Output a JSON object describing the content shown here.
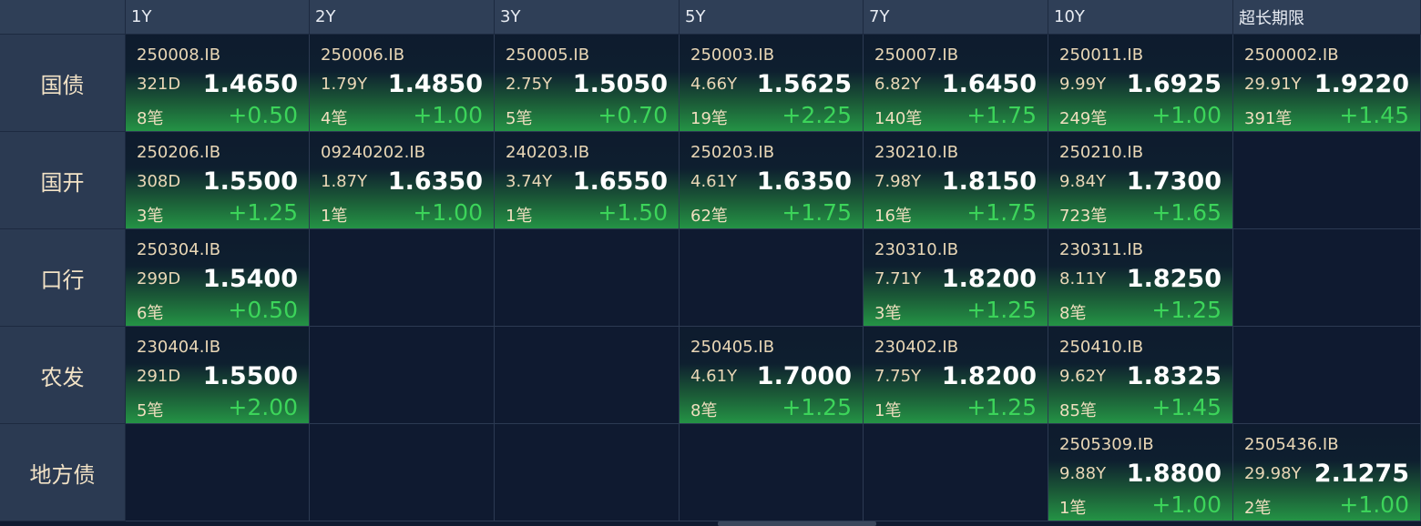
{
  "columns": [
    "1Y",
    "2Y",
    "3Y",
    "5Y",
    "7Y",
    "10Y",
    "超长期限"
  ],
  "rows": [
    {
      "label": "国债",
      "cells": [
        {
          "code": "250008.IB",
          "tenor": "321D",
          "yield": "1.4650",
          "count": "8笔",
          "change": "+0.50"
        },
        {
          "code": "250006.IB",
          "tenor": "1.79Y",
          "yield": "1.4850",
          "count": "4笔",
          "change": "+1.00"
        },
        {
          "code": "250005.IB",
          "tenor": "2.75Y",
          "yield": "1.5050",
          "count": "5笔",
          "change": "+0.70"
        },
        {
          "code": "250003.IB",
          "tenor": "4.66Y",
          "yield": "1.5625",
          "count": "19笔",
          "change": "+2.25"
        },
        {
          "code": "250007.IB",
          "tenor": "6.82Y",
          "yield": "1.6450",
          "count": "140笔",
          "change": "+1.75"
        },
        {
          "code": "250011.IB",
          "tenor": "9.99Y",
          "yield": "1.6925",
          "count": "249笔",
          "change": "+1.00"
        },
        {
          "code": "2500002.IB",
          "tenor": "29.91Y",
          "yield": "1.9220",
          "count": "391笔",
          "change": "+1.45"
        }
      ]
    },
    {
      "label": "国开",
      "cells": [
        {
          "code": "250206.IB",
          "tenor": "308D",
          "yield": "1.5500",
          "count": "3笔",
          "change": "+1.25"
        },
        {
          "code": "09240202.IB",
          "tenor": "1.87Y",
          "yield": "1.6350",
          "count": "1笔",
          "change": "+1.00"
        },
        {
          "code": "240203.IB",
          "tenor": "3.74Y",
          "yield": "1.6550",
          "count": "1笔",
          "change": "+1.50"
        },
        {
          "code": "250203.IB",
          "tenor": "4.61Y",
          "yield": "1.6350",
          "count": "62笔",
          "change": "+1.75"
        },
        {
          "code": "230210.IB",
          "tenor": "7.98Y",
          "yield": "1.8150",
          "count": "16笔",
          "change": "+1.75"
        },
        {
          "code": "250210.IB",
          "tenor": "9.84Y",
          "yield": "1.7300",
          "count": "723笔",
          "change": "+1.65"
        },
        null
      ]
    },
    {
      "label": "口行",
      "cells": [
        {
          "code": "250304.IB",
          "tenor": "299D",
          "yield": "1.5400",
          "count": "6笔",
          "change": "+0.50"
        },
        null,
        null,
        null,
        {
          "code": "230310.IB",
          "tenor": "7.71Y",
          "yield": "1.8200",
          "count": "3笔",
          "change": "+1.25"
        },
        {
          "code": "230311.IB",
          "tenor": "8.11Y",
          "yield": "1.8250",
          "count": "8笔",
          "change": "+1.25"
        },
        null
      ]
    },
    {
      "label": "农发",
      "cells": [
        {
          "code": "230404.IB",
          "tenor": "291D",
          "yield": "1.5500",
          "count": "5笔",
          "change": "+2.00"
        },
        null,
        null,
        {
          "code": "250405.IB",
          "tenor": "4.61Y",
          "yield": "1.7000",
          "count": "8笔",
          "change": "+1.25"
        },
        {
          "code": "230402.IB",
          "tenor": "7.75Y",
          "yield": "1.8200",
          "count": "1笔",
          "change": "+1.25"
        },
        {
          "code": "250410.IB",
          "tenor": "9.62Y",
          "yield": "1.8325",
          "count": "85笔",
          "change": "+1.45"
        },
        null
      ]
    },
    {
      "label": "地方债",
      "cells": [
        null,
        null,
        null,
        null,
        null,
        {
          "code": "2505309.IB",
          "tenor": "9.88Y",
          "yield": "1.8800",
          "count": "1笔",
          "change": "+1.00"
        },
        {
          "code": "2505436.IB",
          "tenor": "29.98Y",
          "yield": "2.1275",
          "count": "2笔",
          "change": "+1.00"
        }
      ]
    }
  ]
}
